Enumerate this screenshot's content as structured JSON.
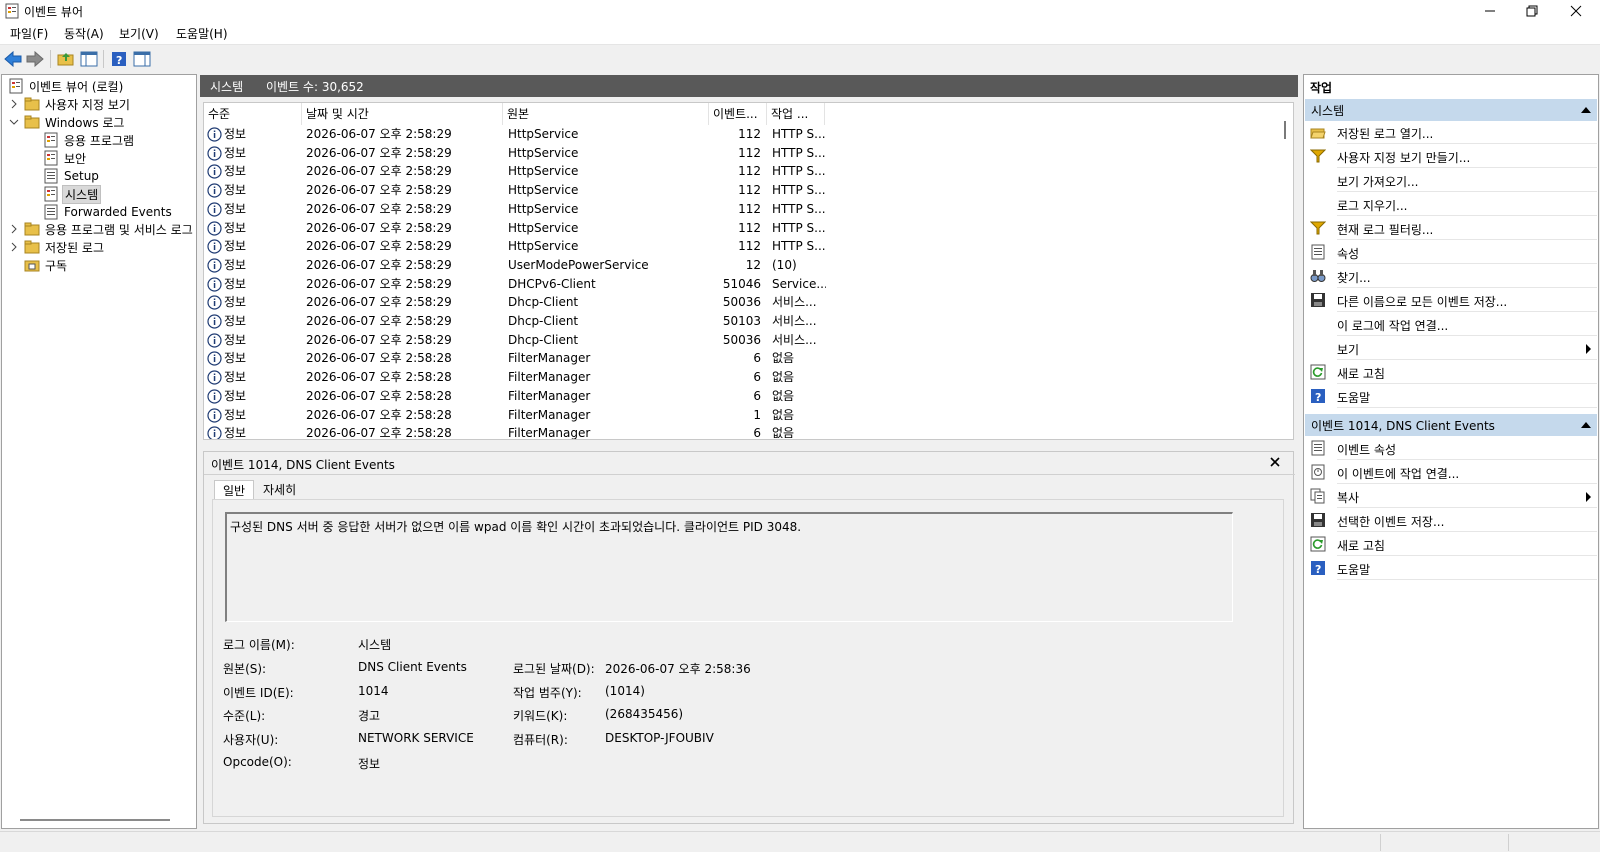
{
  "window": {
    "title": "이벤트 뷰어"
  },
  "menu": [
    "파일(F)",
    "동작(A)",
    "보기(V)",
    "도움말(H)"
  ],
  "tree": {
    "root": "이벤트 뷰어 (로컬)",
    "custom_views": "사용자 지정 보기",
    "windows_logs": "Windows 로그",
    "logs": [
      "응용 프로그램",
      "보안",
      "Setup",
      "시스템",
      "Forwarded Events"
    ],
    "apps_services": "응용 프로그램 및 서비스 로그",
    "saved_logs": "저장된 로그",
    "subscriptions": "구독"
  },
  "center": {
    "title": "시스템",
    "count": "이벤트 수: 30,652",
    "columns": [
      "수준",
      "날짜 및 시간",
      "원본",
      "이벤트...",
      "작업 ..."
    ],
    "rows": [
      {
        "level": "정보",
        "datetime": "2026-06-07 오후 2:58:29",
        "source": "HttpService",
        "id": "112",
        "task": "HTTP S..."
      },
      {
        "level": "정보",
        "datetime": "2026-06-07 오후 2:58:29",
        "source": "HttpService",
        "id": "112",
        "task": "HTTP S..."
      },
      {
        "level": "정보",
        "datetime": "2026-06-07 오후 2:58:29",
        "source": "HttpService",
        "id": "112",
        "task": "HTTP S..."
      },
      {
        "level": "정보",
        "datetime": "2026-06-07 오후 2:58:29",
        "source": "HttpService",
        "id": "112",
        "task": "HTTP S..."
      },
      {
        "level": "정보",
        "datetime": "2026-06-07 오후 2:58:29",
        "source": "HttpService",
        "id": "112",
        "task": "HTTP S..."
      },
      {
        "level": "정보",
        "datetime": "2026-06-07 오후 2:58:29",
        "source": "HttpService",
        "id": "112",
        "task": "HTTP S..."
      },
      {
        "level": "정보",
        "datetime": "2026-06-07 오후 2:58:29",
        "source": "HttpService",
        "id": "112",
        "task": "HTTP S..."
      },
      {
        "level": "정보",
        "datetime": "2026-06-07 오후 2:58:29",
        "source": "UserModePowerService",
        "id": "12",
        "task": "(10)"
      },
      {
        "level": "정보",
        "datetime": "2026-06-07 오후 2:58:29",
        "source": "DHCPv6-Client",
        "id": "51046",
        "task": "Service..."
      },
      {
        "level": "정보",
        "datetime": "2026-06-07 오후 2:58:29",
        "source": "Dhcp-Client",
        "id": "50036",
        "task": "서비스..."
      },
      {
        "level": "정보",
        "datetime": "2026-06-07 오후 2:58:29",
        "source": "Dhcp-Client",
        "id": "50103",
        "task": "서비스..."
      },
      {
        "level": "정보",
        "datetime": "2026-06-07 오후 2:58:29",
        "source": "Dhcp-Client",
        "id": "50036",
        "task": "서비스..."
      },
      {
        "level": "정보",
        "datetime": "2026-06-07 오후 2:58:28",
        "source": "FilterManager",
        "id": "6",
        "task": "없음"
      },
      {
        "level": "정보",
        "datetime": "2026-06-07 오후 2:58:28",
        "source": "FilterManager",
        "id": "6",
        "task": "없음"
      },
      {
        "level": "정보",
        "datetime": "2026-06-07 오후 2:58:28",
        "source": "FilterManager",
        "id": "6",
        "task": "없음"
      },
      {
        "level": "정보",
        "datetime": "2026-06-07 오후 2:58:28",
        "source": "FilterManager",
        "id": "1",
        "task": "없음"
      },
      {
        "level": "정보",
        "datetime": "2026-06-07 오후 2:58:28",
        "source": "FilterManager",
        "id": "6",
        "task": "없음"
      }
    ]
  },
  "detail": {
    "title": "이벤트 1014, DNS Client Events",
    "tabs": [
      "일반",
      "자세히"
    ],
    "description": "구성된 DNS 서버 중 응답한 서버가 없으면 이름 wpad 이름 확인 시간이 초과되었습니다. 클라이언트 PID 3048.",
    "log_name_label": "로그 이름(M):",
    "log_name": "시스템",
    "source_label": "원본(S):",
    "source": "DNS Client Events",
    "logged_label": "로그된 날짜(D):",
    "logged": "2026-06-07 오후 2:58:36",
    "event_id_label": "이벤트 ID(E):",
    "event_id": "1014",
    "task_label": "작업 범주(Y):",
    "task": "(1014)",
    "level_label": "수준(L):",
    "level": "경고",
    "keywords_label": "키워드(K):",
    "keywords": "(268435456)",
    "user_label": "사용자(U):",
    "user": "NETWORK SERVICE",
    "computer_label": "컴퓨터(R):",
    "computer": "DESKTOP-JFOUBIV",
    "opcode_label": "Opcode(O):",
    "opcode": "정보"
  },
  "actions": {
    "title": "작업",
    "section1": "시스템",
    "items1": [
      {
        "label": "저장된 로그 열기...",
        "icon": "folder-open-icon"
      },
      {
        "label": "사용자 지정 보기 만들기...",
        "icon": "filter-icon"
      },
      {
        "label": "보기 가져오기...",
        "icon": ""
      },
      {
        "label": "로그 지우기...",
        "icon": ""
      },
      {
        "label": "현재 로그 필터링...",
        "icon": "filter-icon"
      },
      {
        "label": "속성",
        "icon": "properties-icon"
      },
      {
        "label": "찾기...",
        "icon": "binoculars-icon"
      },
      {
        "label": "다른 이름으로 모든 이벤트 저장...",
        "icon": "save-icon"
      },
      {
        "label": "이 로그에 작업 연결...",
        "icon": ""
      },
      {
        "label": "보기",
        "icon": "",
        "submenu": true
      },
      {
        "label": "새로 고침",
        "icon": "refresh-icon"
      },
      {
        "label": "도움말",
        "icon": "help-icon"
      }
    ],
    "section2": "이벤트 1014, DNS Client Events",
    "items2": [
      {
        "label": "이벤트 속성",
        "icon": "properties-icon"
      },
      {
        "label": "이 이벤트에 작업 연결...",
        "icon": "task-icon"
      },
      {
        "label": "복사",
        "icon": "copy-icon",
        "submenu": true
      },
      {
        "label": "선택한 이벤트 저장...",
        "icon": "save-icon"
      },
      {
        "label": "새로 고침",
        "icon": "refresh-icon"
      },
      {
        "label": "도움말",
        "icon": "help-icon"
      }
    ]
  },
  "colors": {
    "header_bg": "#595959",
    "section_bg": "#c5d9ec",
    "info_blue": "#1f3b73"
  }
}
